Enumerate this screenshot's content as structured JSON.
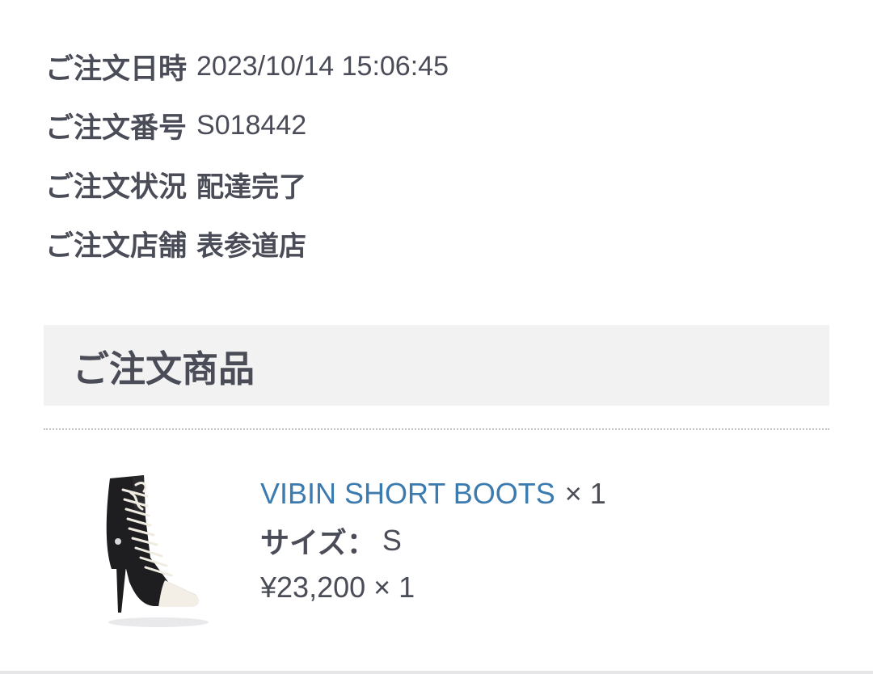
{
  "order_info": {
    "rows": [
      {
        "label": "ご注文日時",
        "value": "2023/10/14 15:06:45"
      },
      {
        "label": "ご注文番号",
        "value": "S018442"
      },
      {
        "label": "ご注文状況",
        "value": "配達完了"
      },
      {
        "label": "ご注文店舗",
        "value": "表参道店"
      }
    ]
  },
  "products_section": {
    "title": "ご注文商品"
  },
  "product": {
    "name": "VIBIN SHORT BOOTS",
    "name_qty": "× 1",
    "size_label": "サイズ：",
    "size_value": "S",
    "price": "¥23,200 × 1",
    "image_icon": "boot-product-image"
  },
  "colors": {
    "text": "#4a4c57",
    "link": "#3c7bb0",
    "section_bg": "#f2f2f2"
  }
}
